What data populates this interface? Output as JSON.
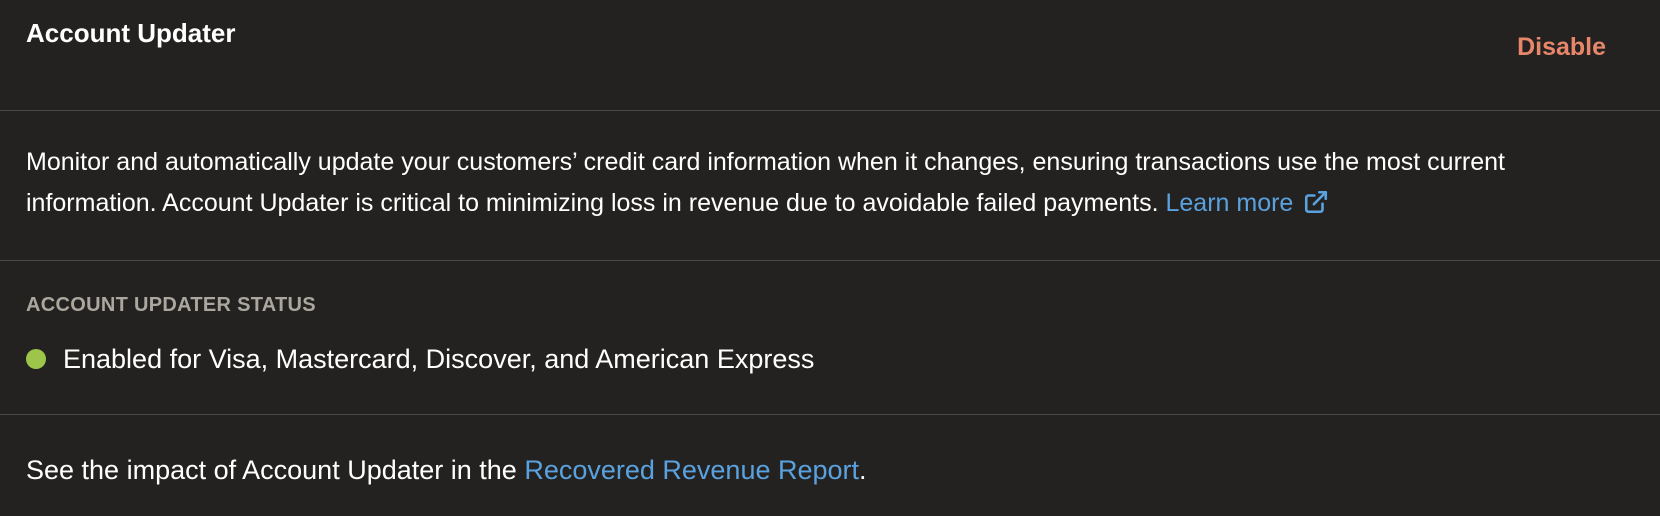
{
  "header": {
    "title": "Account Updater",
    "disable_label": "Disable"
  },
  "description": {
    "text": "Monitor and automatically update your customers’ credit card information when it changes, ensuring transactions use the most current information. Account Updater is critical to minimizing loss in revenue due to avoidable failed payments.",
    "learn_more_label": "Learn more",
    "learn_more_icon": "external-link-icon"
  },
  "status": {
    "label": "ACCOUNT UPDATER STATUS",
    "text": "Enabled for Visa, Mastercard, Discover, and American Express",
    "indicator_color": "#9cc54a"
  },
  "footer": {
    "prefix": "See the impact of Account Updater in the",
    "link_label": "Recovered Revenue Report",
    "suffix": "."
  },
  "colors": {
    "background": "#232221",
    "divider": "#4a4948",
    "link": "#5aa2df",
    "danger": "#e8866a",
    "muted_label": "#aaa79e"
  }
}
